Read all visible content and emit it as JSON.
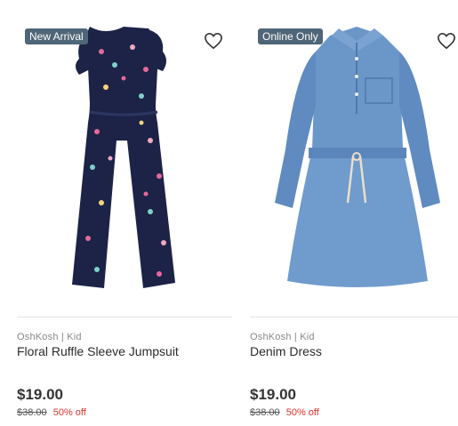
{
  "products": [
    {
      "badge": "New Arrival",
      "brand": "OshKosh | Kid",
      "name": "Floral Ruffle Sleeve Jumpsuit",
      "price": "$19.00",
      "original_price": "$38.00",
      "discount": "50% off",
      "image_icon": "jumpsuit-image"
    },
    {
      "badge": "Online Only",
      "brand": "OshKosh | Kid",
      "name": "Denim Dress",
      "price": "$19.00",
      "original_price": "$38.00",
      "discount": "50% off",
      "image_icon": "dress-image"
    }
  ],
  "colors": {
    "badge_bg": "#4e6677",
    "discount": "#e0322c",
    "navy": "#1c2347",
    "denim": "#6b96c8"
  }
}
